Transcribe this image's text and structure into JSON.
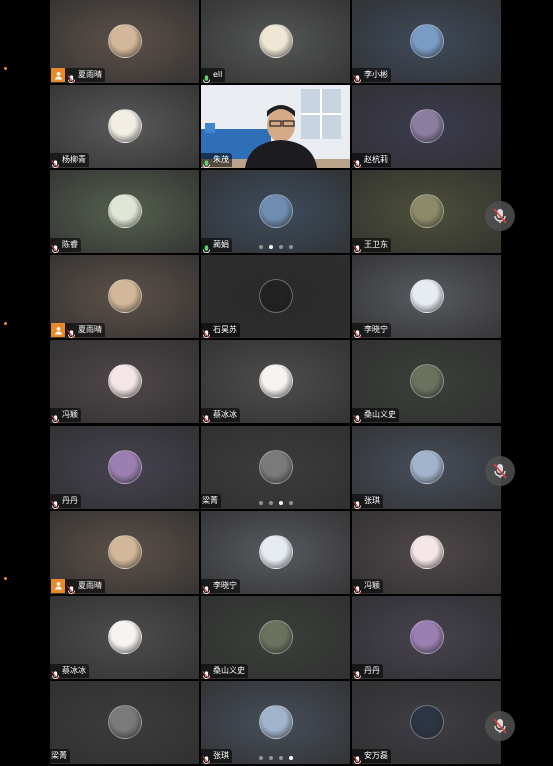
{
  "tiles": [
    {
      "name": "夏雨晴",
      "host": true,
      "mic": "muted",
      "bg": "#5d514a",
      "av": "#d2b79a"
    },
    {
      "name": "ell",
      "host": false,
      "mic": "on",
      "bg": "#555856",
      "av": "#efe7d6"
    },
    {
      "name": "李小彬",
      "host": false,
      "mic": "muted",
      "bg": "#3f4a5a",
      "av": "#7a9bc4"
    },
    {
      "name": "杨柳青",
      "host": false,
      "mic": "muted",
      "bg": "#5a5a5a",
      "av": "#f2eee6"
    },
    {
      "name": "朱茂",
      "host": false,
      "mic": "on",
      "bg": "#4a6b8a",
      "av": "",
      "video": true
    },
    {
      "name": "赵杭莉",
      "host": false,
      "mic": "muted",
      "bg": "#3c3b4e",
      "av": "#8a7fa0"
    },
    {
      "name": "陈睿",
      "host": false,
      "mic": "muted",
      "bg": "#566050",
      "av": "#dfe6d6"
    },
    {
      "name": "蔺娟",
      "host": false,
      "mic": "on",
      "bg": "#3e4c5c",
      "av": "#6f8db0"
    },
    {
      "name": "王卫东",
      "host": false,
      "mic": "muted",
      "bg": "#4d4f3a",
      "av": "#8c8a6a"
    },
    {
      "name": "夏雨晴",
      "host": true,
      "mic": "muted",
      "bg": "#5d514a",
      "av": "#d2b79a"
    },
    {
      "name": "石昊苏",
      "host": false,
      "mic": "muted",
      "bg": "#2a2a2a",
      "av": "#222"
    },
    {
      "name": "李晓宁",
      "host": false,
      "mic": "muted",
      "bg": "#585a60",
      "av": "#e7ecf2"
    },
    {
      "name": "冯颖",
      "host": false,
      "mic": "muted",
      "bg": "#4f4749",
      "av": "#f4e6e6"
    },
    {
      "name": "蔡冰冰",
      "host": false,
      "mic": "muted",
      "bg": "#4e4d4d",
      "av": "#f7f3f0"
    },
    {
      "name": "桑山义史",
      "host": false,
      "mic": "muted",
      "bg": "#3b3f3b",
      "av": "#6a725e"
    },
    {
      "name": "丹丹",
      "host": false,
      "mic": "muted",
      "bg": "#464250",
      "av": "#9b7fb0"
    },
    {
      "name": "梁菁",
      "host": false,
      "mic": "none",
      "bg": "#3c3c3c",
      "av": "#7a7a7a"
    },
    {
      "name": "张琪",
      "host": false,
      "mic": "muted",
      "bg": "#474e5a",
      "av": "#a2b4cc"
    },
    {
      "name": "夏雨晴",
      "host": true,
      "mic": "muted",
      "bg": "#5d514a",
      "av": "#d2b79a"
    },
    {
      "name": "李晓宁",
      "host": false,
      "mic": "muted",
      "bg": "#585a60",
      "av": "#e7ecf2"
    },
    {
      "name": "冯颖",
      "host": false,
      "mic": "muted",
      "bg": "#4f4749",
      "av": "#f4e6e6"
    },
    {
      "name": "蔡冰冰",
      "host": false,
      "mic": "muted",
      "bg": "#4e4d4d",
      "av": "#f7f3f0"
    },
    {
      "name": "桑山义史",
      "host": false,
      "mic": "muted",
      "bg": "#3b3f3b",
      "av": "#6a725e"
    },
    {
      "name": "丹丹",
      "host": false,
      "mic": "muted",
      "bg": "#464250",
      "av": "#9b7fb0"
    },
    {
      "name": "梁菁",
      "host": false,
      "mic": "none",
      "bg": "#3c3c3c",
      "av": "#7a7a7a"
    },
    {
      "name": "张琪",
      "host": false,
      "mic": "muted",
      "bg": "#474e5a",
      "av": "#a2b4cc"
    },
    {
      "name": "安万磊",
      "host": false,
      "mic": "muted",
      "bg": "#3d3d44",
      "av": "#2d3444"
    }
  ],
  "pagers": [
    {
      "count": 4,
      "active": 1
    },
    {
      "count": 4,
      "active": 2
    },
    {
      "count": 4,
      "active": 3
    }
  ],
  "colors": {
    "host": "#e98a2a",
    "active_border": "#3ccf6a",
    "muted_mic": "#e04040"
  },
  "icons": [
    "host-badge-icon",
    "mic-icon",
    "mic-muted-icon",
    "audio-muted-icon"
  ]
}
